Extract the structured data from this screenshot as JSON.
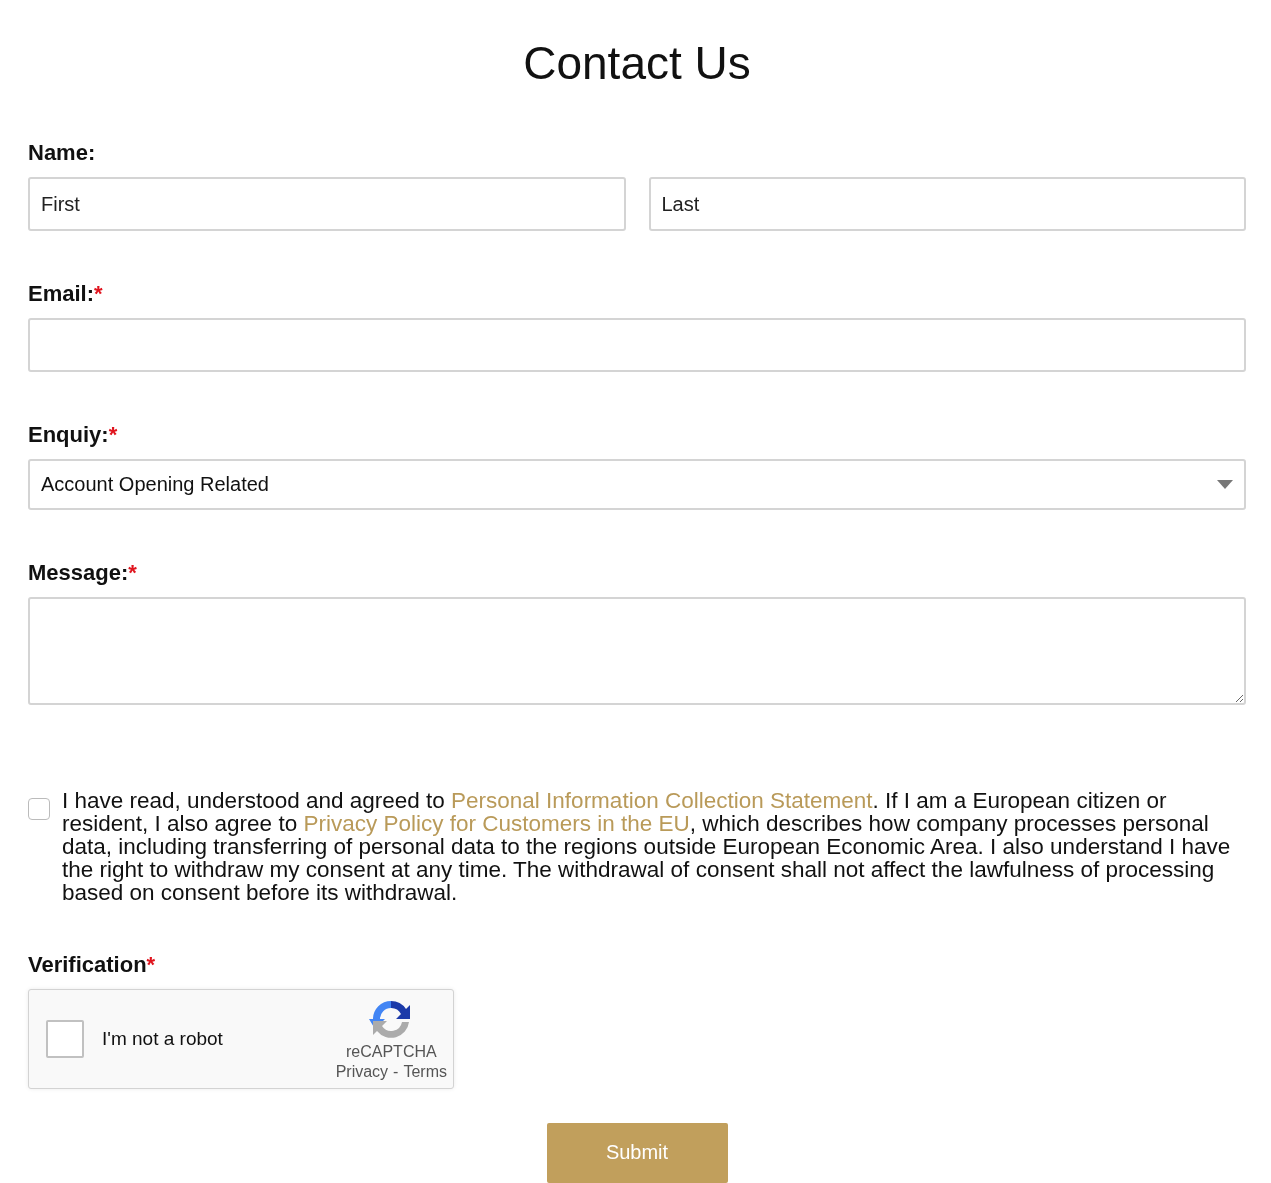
{
  "title": "Contact Us",
  "name": {
    "label": "Name:",
    "first": {
      "placeholder": "First"
    },
    "last": {
      "placeholder": "Last"
    }
  },
  "email": {
    "label": "Email:",
    "mark": "*"
  },
  "enquiry": {
    "label": "Enquiy:",
    "mark": "*",
    "value": "Account Opening Related"
  },
  "message": {
    "label": "Message:",
    "mark": "*"
  },
  "consent": {
    "checked": false,
    "parts": [
      {
        "kind": "text",
        "text": "I have read, understood and agreed to "
      },
      {
        "kind": "link",
        "text": "Personal Information Collection Statement"
      },
      {
        "kind": "text",
        "text": ". If I am a European citizen or resident, I also agree to "
      },
      {
        "kind": "link",
        "text": "Privacy Policy for Customers in the EU"
      },
      {
        "kind": "text",
        "text": ", which describes how company processes personal data, including transferring of personal data to the regions outside European Economic Area. I also understand I have the right to withdraw my consent at any time. The withdrawal of consent shall not affect the lawfulness of processing based on consent before its withdrawal."
      }
    ]
  },
  "verification": {
    "label": "Verification",
    "mark": "*",
    "captcha": {
      "checked": false,
      "label": "I'm not a robot",
      "brand": "reCAPTCHA",
      "privacy": "Privacy",
      "separator": "-",
      "terms": "Terms"
    }
  },
  "submit": "Submit"
}
